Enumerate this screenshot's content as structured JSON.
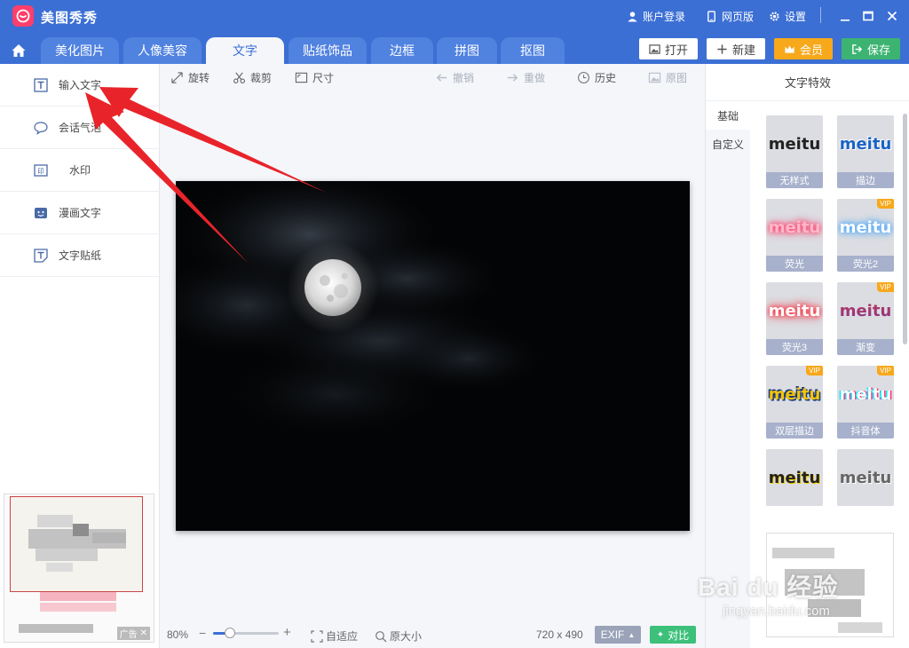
{
  "app": {
    "title": "美图秀秀"
  },
  "titlebar": {
    "account": "账户登录",
    "web": "网页版",
    "settings": "设置"
  },
  "tabs": [
    {
      "label": "美化图片"
    },
    {
      "label": "人像美容"
    },
    {
      "label": "文字"
    },
    {
      "label": "贴纸饰品"
    },
    {
      "label": "边框"
    },
    {
      "label": "拼图"
    },
    {
      "label": "抠图"
    }
  ],
  "header_buttons": {
    "open": "打开",
    "new": "新建",
    "vip": "会员",
    "save": "保存"
  },
  "left_menu": [
    {
      "label": "输入文字"
    },
    {
      "label": "会话气泡"
    },
    {
      "label": "水印"
    },
    {
      "label": "漫画文字"
    },
    {
      "label": "文字贴纸"
    }
  ],
  "ad": {
    "tag": "广告"
  },
  "toolbar": {
    "rotate": "旋转",
    "crop": "裁剪",
    "size": "尺寸",
    "undo": "撤销",
    "redo": "重做",
    "history": "历史",
    "original": "原图"
  },
  "bottom": {
    "zoom": "80%",
    "zoom_level": 0.25,
    "fit": "自适应",
    "actual": "原大小",
    "dimensions": "720 x 490",
    "exif": "EXIF",
    "compare": "对比"
  },
  "right_panel": {
    "title": "文字特效",
    "side_tabs": [
      {
        "label": "基础"
      },
      {
        "label": "自定义"
      }
    ],
    "effects": [
      {
        "sample": "meitu",
        "label": "无样式",
        "vip": false
      },
      {
        "sample": "meitu",
        "label": "描边",
        "vip": false
      },
      {
        "sample": "meitu",
        "label": "荧光",
        "vip": false
      },
      {
        "sample": "meitu",
        "label": "荧光2",
        "vip": true
      },
      {
        "sample": "meitu",
        "label": "荧光3",
        "vip": false
      },
      {
        "sample": "meitu",
        "label": "渐变",
        "vip": true
      },
      {
        "sample": "meitu",
        "label": "双层描边",
        "vip": true
      },
      {
        "sample": "meitu",
        "label": "抖音体",
        "vip": true
      },
      {
        "sample": "meitu",
        "label": "",
        "vip": false
      },
      {
        "sample": "meitu",
        "label": "",
        "vip": false
      }
    ],
    "vip_tag": "VIP"
  },
  "watermark": {
    "main": "Bai du 经验",
    "sub": "jingyan.baidu.com"
  },
  "colors": {
    "primary": "#3b6fd4",
    "vip": "#f7a81b",
    "save": "#3cb371",
    "arrow": "#e8242a"
  }
}
